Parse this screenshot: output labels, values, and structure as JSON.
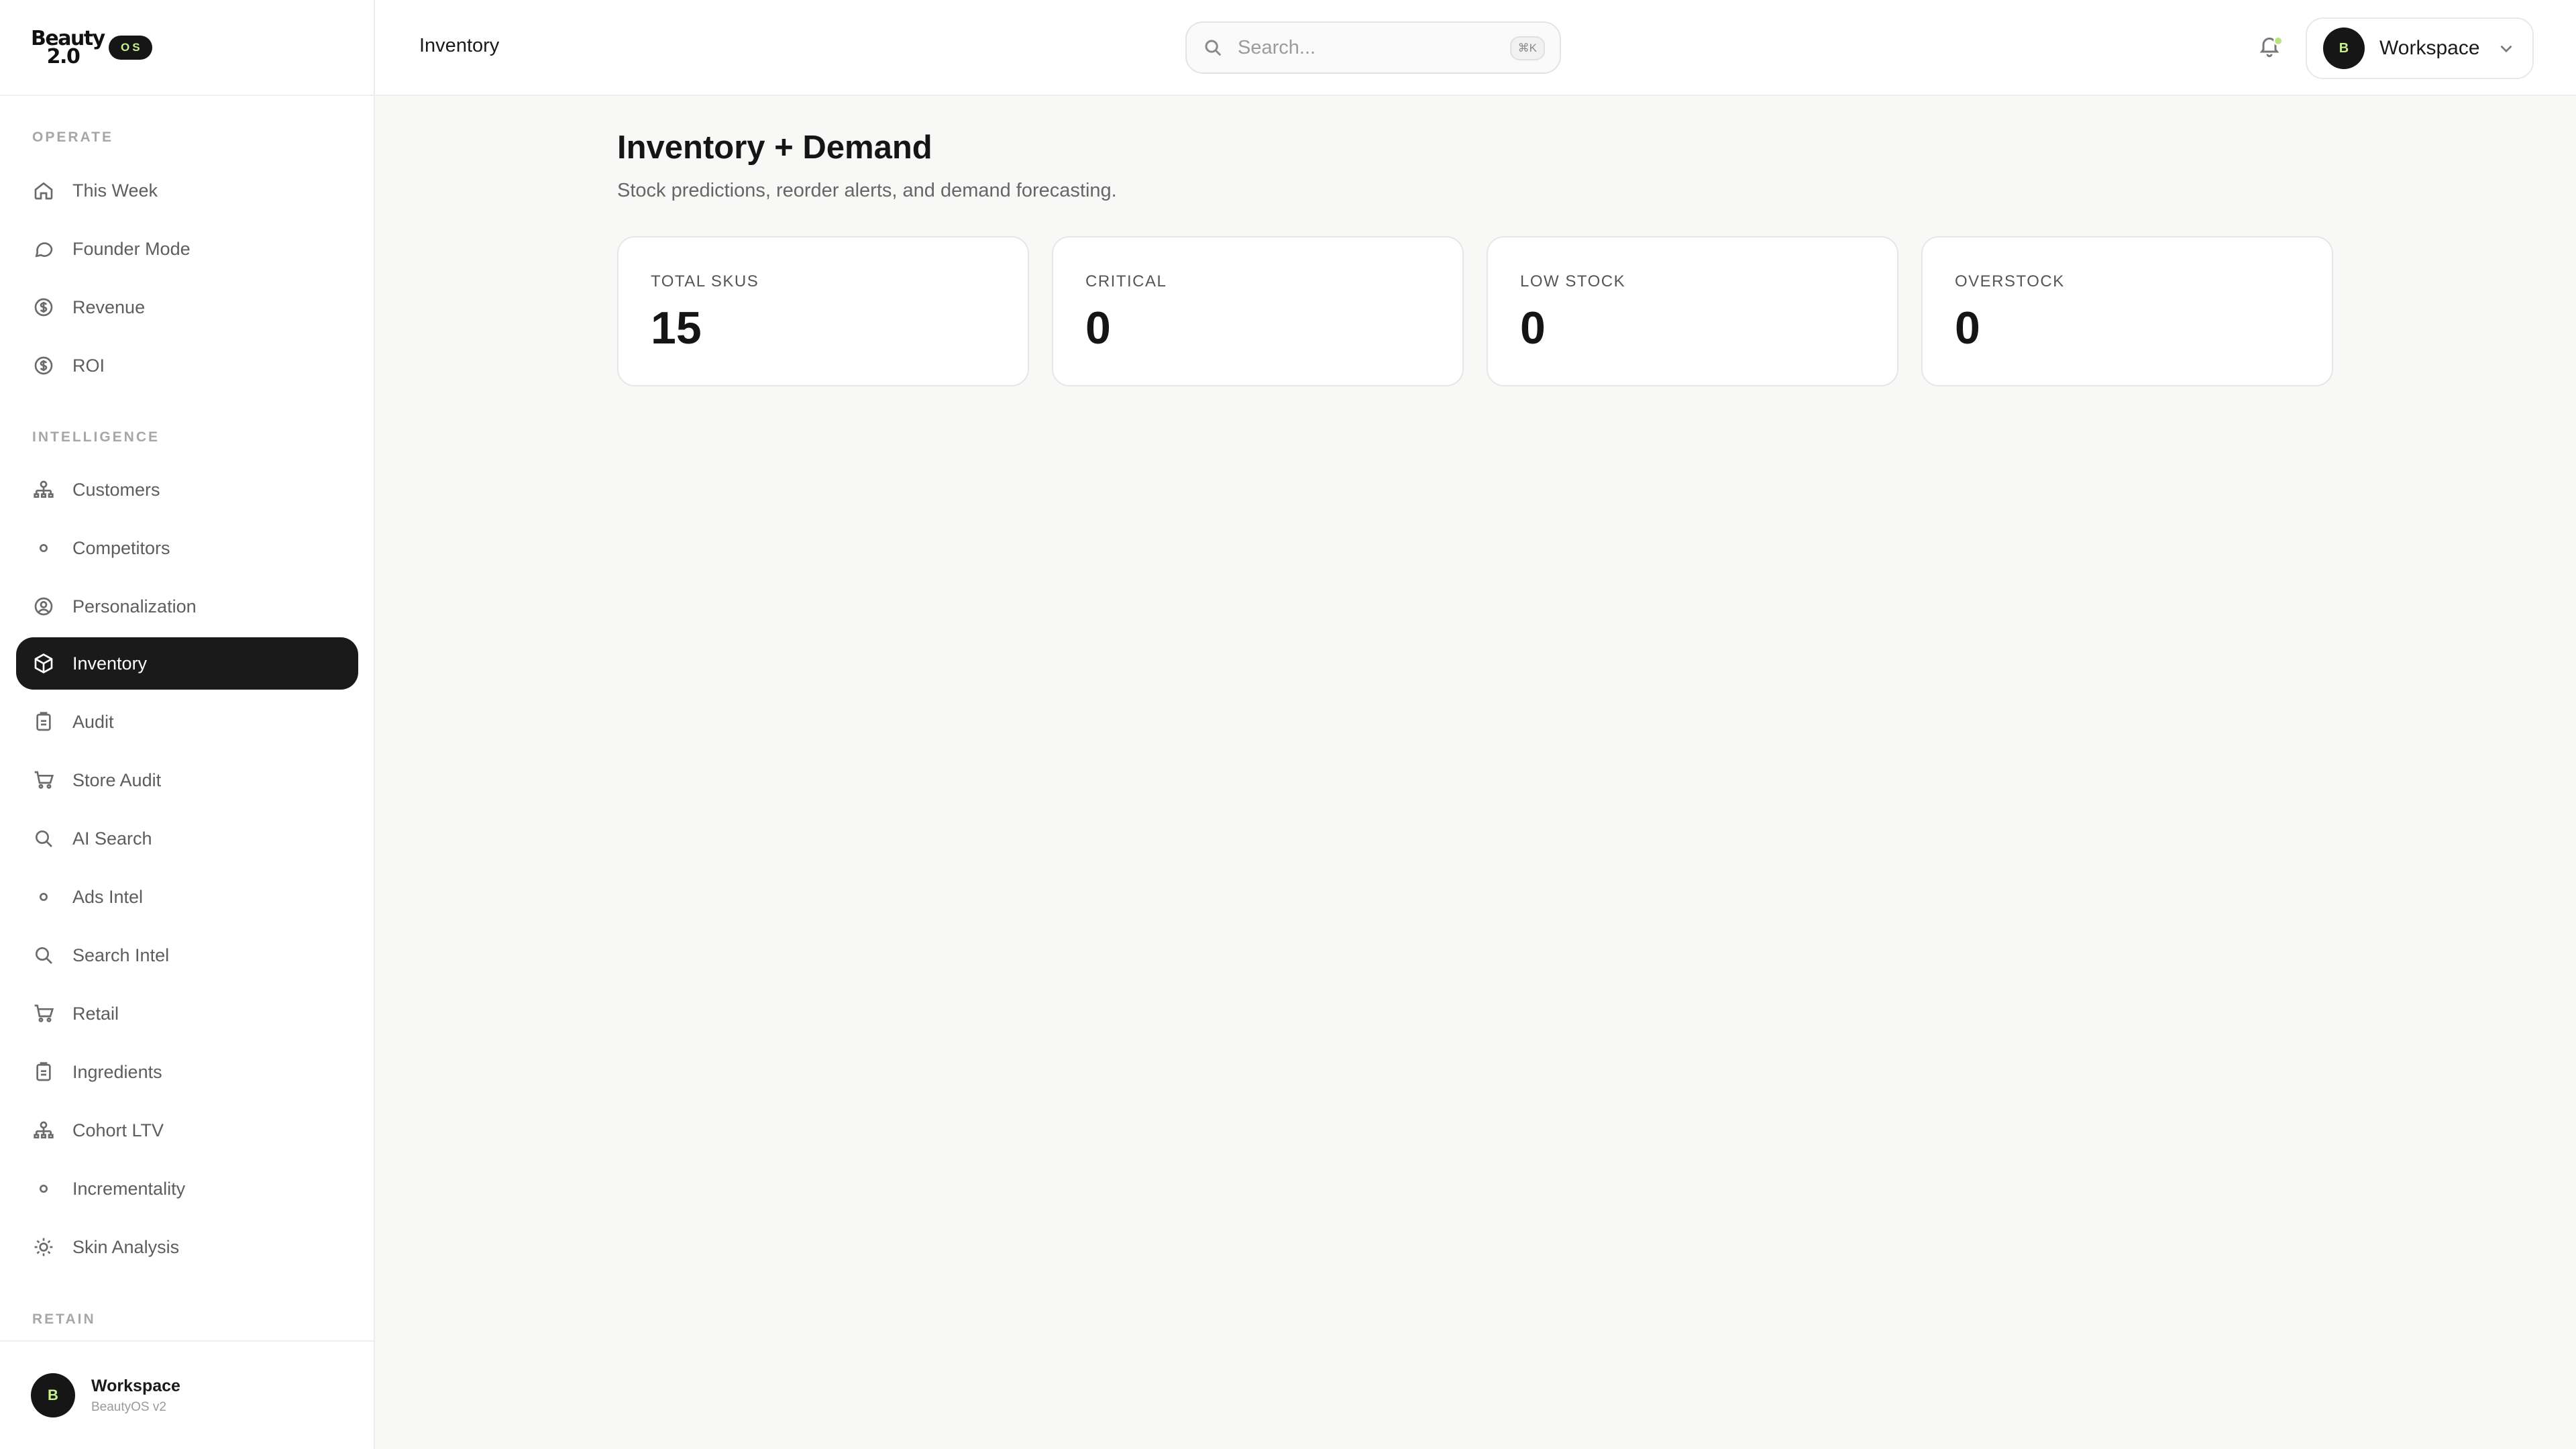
{
  "brand": {
    "logo_line1": "Beauty",
    "logo_line2": "2.0",
    "badge": "OS"
  },
  "sidebar": {
    "sections": [
      {
        "label": "OPERATE"
      },
      {
        "label": "INTELLIGENCE"
      },
      {
        "label": "RETAIN"
      }
    ],
    "items": [
      {
        "label": "This Week",
        "icon": "home-icon"
      },
      {
        "label": "Founder Mode",
        "icon": "chat-icon"
      },
      {
        "label": "Revenue",
        "icon": "dollar-icon"
      },
      {
        "label": "ROI",
        "icon": "dollar-icon"
      },
      {
        "label": "Customers",
        "icon": "network-icon"
      },
      {
        "label": "Competitors",
        "icon": "dot-icon"
      },
      {
        "label": "Personalization",
        "icon": "user-circle-icon"
      },
      {
        "label": "Inventory",
        "icon": "box-icon",
        "active": true
      },
      {
        "label": "Audit",
        "icon": "clipboard-icon"
      },
      {
        "label": "Store Audit",
        "icon": "cart-icon"
      },
      {
        "label": "AI Search",
        "icon": "search-icon"
      },
      {
        "label": "Ads Intel",
        "icon": "dot-icon"
      },
      {
        "label": "Search Intel",
        "icon": "search-icon"
      },
      {
        "label": "Retail",
        "icon": "cart-icon"
      },
      {
        "label": "Ingredients",
        "icon": "clipboard-icon"
      },
      {
        "label": "Cohort LTV",
        "icon": "network-icon"
      },
      {
        "label": "Incrementality",
        "icon": "dot-icon"
      },
      {
        "label": "Skin Analysis",
        "icon": "sun-icon"
      }
    ],
    "footer": {
      "avatar": "B",
      "name": "Workspace",
      "subtitle": "BeautyOS v2"
    }
  },
  "header": {
    "title": "Inventory",
    "search": {
      "placeholder": "Search...",
      "shortcut": "⌘K"
    },
    "workspace": {
      "avatar": "B",
      "name": "Workspace"
    }
  },
  "main": {
    "title": "Inventory + Demand",
    "subtitle": "Stock predictions, reorder alerts, and demand forecasting.",
    "stats": [
      {
        "label": "TOTAL SKUS",
        "value": "15"
      },
      {
        "label": "CRITICAL",
        "value": "0"
      },
      {
        "label": "LOW STOCK",
        "value": "0"
      },
      {
        "label": "OVERSTOCK",
        "value": "0"
      }
    ]
  },
  "colors": {
    "accent": "#c8f08c",
    "active_bg": "#1a1a1a",
    "background": "#f8f8f7"
  }
}
